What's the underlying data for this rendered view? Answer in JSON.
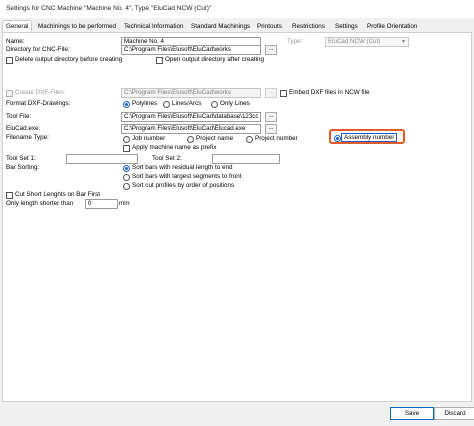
{
  "window": {
    "title": "Settings for CNC Machine \"Machine No. 4\", Type \"EluCad NCW (Cut)\""
  },
  "tabs": [
    "General",
    "Machinings to be performed",
    "Technical Information",
    "Standard Machinings",
    "Printouts",
    "Restrictions",
    "Settings",
    "Profile Orientation"
  ],
  "general": {
    "machine_name_label": "Name:",
    "machine_name": "Machine No. 4",
    "type_label": "Type:",
    "type_value": "EluCad NCW (Cut)",
    "directory_label": "Directory for CNC-File:",
    "directory_value": "C:\\Program Files\\Elusoft\\EluCad\\works",
    "delete_output_label": "Delete output directory before creating",
    "open_output_label": "Open output directory after creating",
    "create_dxf_label": "Create DXF-Files:",
    "create_dxf_value": "C:\\Program Files\\Elusoft\\EluCad\\works",
    "embed_dxf_label": "Embed DXF files in NCW file",
    "format_dxf_label": "Format DXF-Drawings:",
    "format_options": [
      "Polylines",
      "Lines/Arcs",
      "Only Lines"
    ],
    "tool_file_label": "Tool File:",
    "tool_file_value": "C:\\Program Files\\Elusoft\\EluCad\\database\\123cc",
    "elucad_exe_label": "EluCad.exe:",
    "elucad_exe_value": "C:\\Program Files\\Elusoft\\EluCad\\Elucad.exe",
    "filename_type_label": "Filename Type:",
    "filename_options": [
      "Job number",
      "Project name",
      "Project number",
      "Assembly number"
    ],
    "apply_machine_label": "Apply machine name as prefix",
    "tool_set1_label": "Tool Set 1:",
    "tool_set2_label": "Tool Set 2:",
    "bar_sorting_label": "Bar Sorting:",
    "bar_sorting_options": [
      "Sort bars with residual length to end",
      "Sort bars with largest segments to front",
      "Sort cut profiles by order of positions"
    ],
    "cut_short_label": "Cut Short Lenghts on Bar First",
    "only_length_label": "Only length shorter than",
    "only_length_value": "0",
    "only_length_unit": "mm",
    "browse_label": "..."
  },
  "footer": {
    "save": "Save",
    "discard": "Discard"
  },
  "colors": {
    "highlight": "#e05a2b",
    "accent": "#1c5fc4"
  }
}
